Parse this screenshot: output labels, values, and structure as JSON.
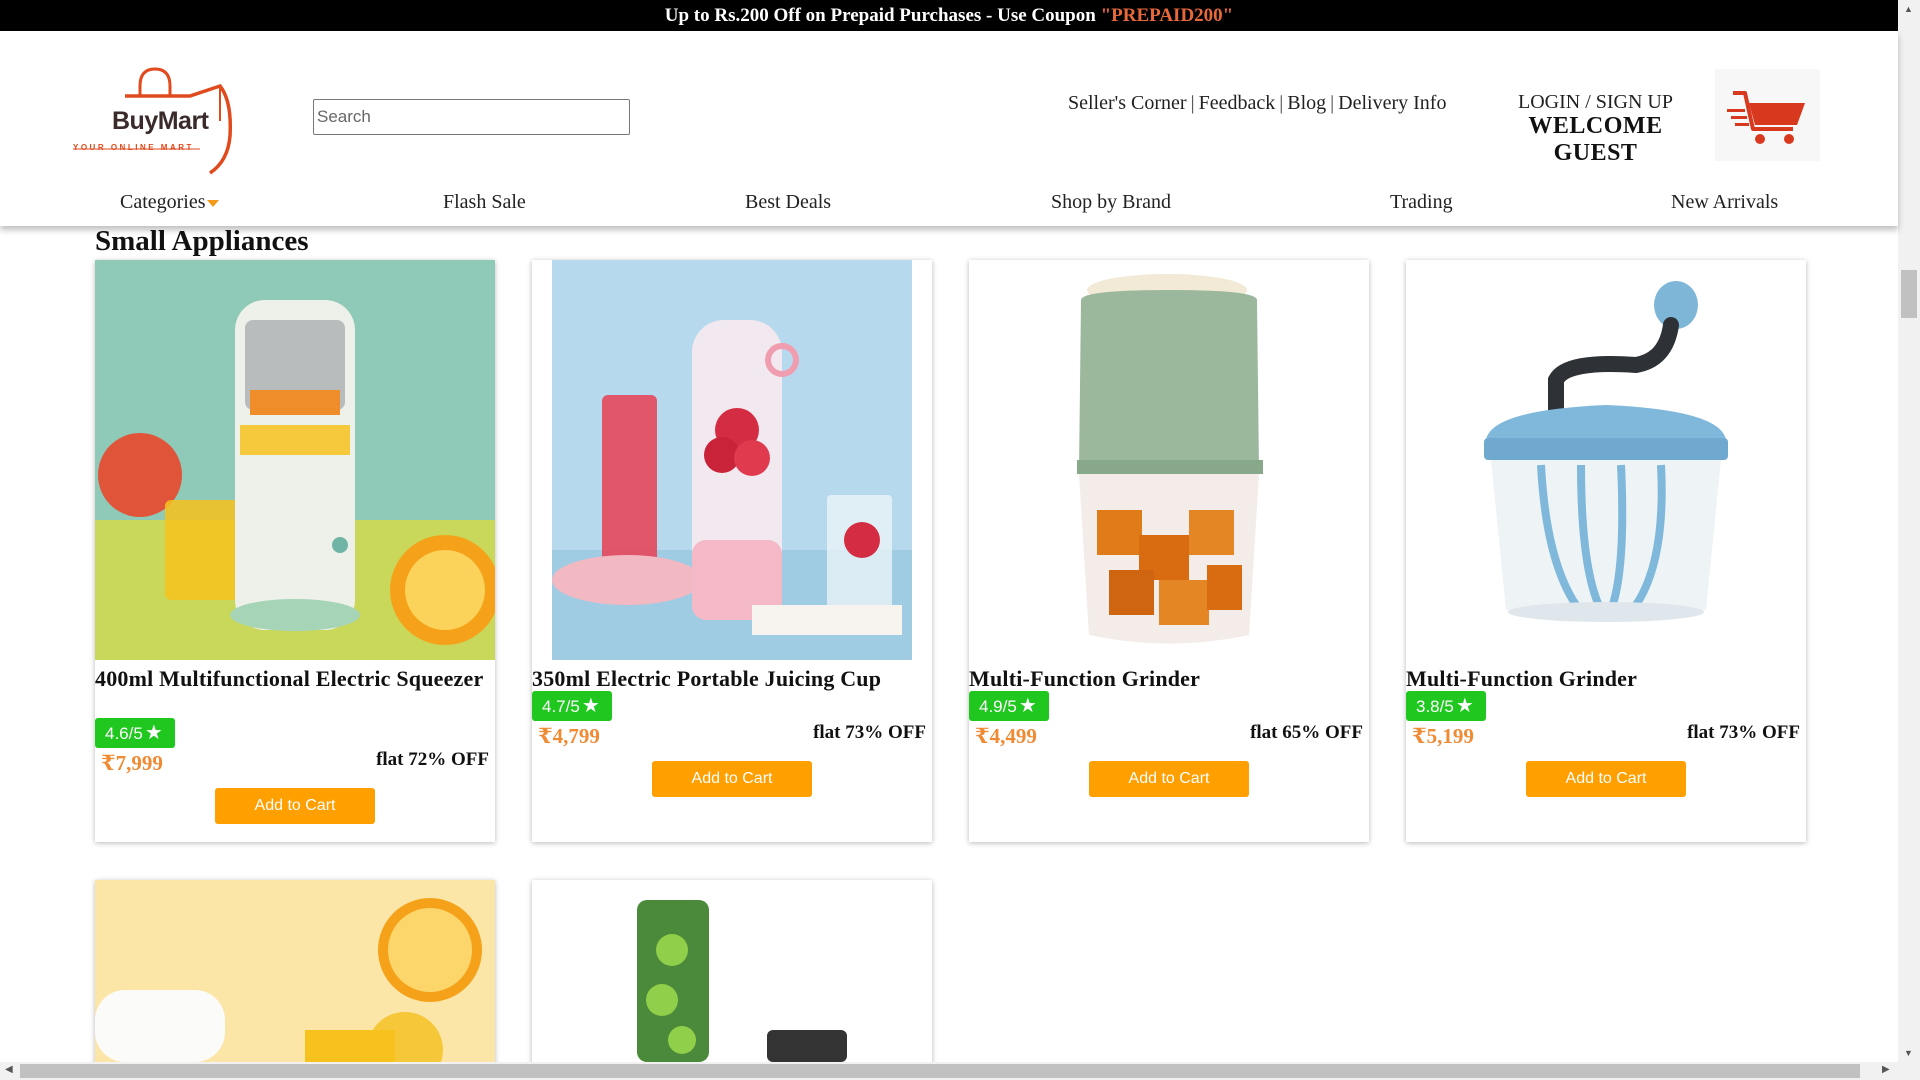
{
  "promo": {
    "text": "Up to Rs.200 Off on Prepaid Purchases - Use Coupon ",
    "coupon": "\"PREPAID200\""
  },
  "logo": {
    "name": "BuyMart",
    "tagline": "YOUR ONLINE MART"
  },
  "search": {
    "placeholder": "Search",
    "value": ""
  },
  "top_links": [
    "Seller's Corner",
    "Feedback",
    "Blog",
    "Delivery Info"
  ],
  "account": {
    "login_label": "LOGIN / SIGN UP",
    "welcome": "WELCOME GUEST"
  },
  "nav": [
    "Categories",
    "Flash Sale",
    "Best Deals",
    "Shop by Brand",
    "Trading",
    "New Arrivals"
  ],
  "section_title": "Small Appliances",
  "colors": {
    "accent": "#ff9f00",
    "price": "#f08a33",
    "rating": "#1fc71f",
    "brand": "#e04a1d"
  },
  "products": [
    {
      "name": "400ml Multifunctional Electric Squeezer",
      "rating": "4.6/5",
      "price": "₹7,999",
      "discount": "flat 72% OFF",
      "button": "Add to Cart"
    },
    {
      "name": "350ml Electric Portable Juicing Cup",
      "rating": "4.7/5",
      "price": "₹4,799",
      "discount": "flat 73% OFF",
      "button": "Add to Cart"
    },
    {
      "name": "Multi-Function Grinder",
      "rating": "4.9/5",
      "price": "₹4,499",
      "discount": "flat 65% OFF",
      "button": "Add to Cart"
    },
    {
      "name": "Multi-Function Grinder",
      "rating": "3.8/5",
      "price": "₹5,199",
      "discount": "flat 73% OFF",
      "button": "Add to Cart"
    }
  ]
}
